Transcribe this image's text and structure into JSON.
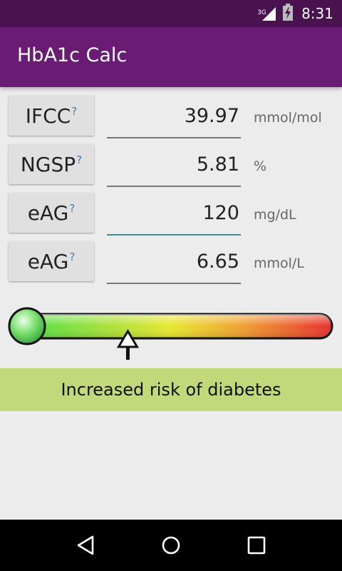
{
  "status_bar": {
    "network": "3G",
    "time": "8:31"
  },
  "app_bar": {
    "title": "HbA1c Calc"
  },
  "rows": [
    {
      "label": "IFCC",
      "help": "?",
      "value": "39.97",
      "unit": "mmol/mol"
    },
    {
      "label": "NGSP",
      "help": "?",
      "value": "5.81",
      "unit": "%"
    },
    {
      "label": "eAG",
      "help": "?",
      "value": "120",
      "unit": "mg/dL"
    },
    {
      "label": "eAG",
      "help": "?",
      "value": "6.65",
      "unit": "mmol/L"
    }
  ],
  "gauge": {
    "pointer_fraction": 0.366
  },
  "risk": {
    "text": "Increased risk of diabetes",
    "color": "#c2d87a"
  },
  "colors": {
    "status_bar": "#4a1350",
    "app_bar": "#6a1b73",
    "focus_underline": "#3f8f8f",
    "help_mark": "#3a7fb0"
  }
}
